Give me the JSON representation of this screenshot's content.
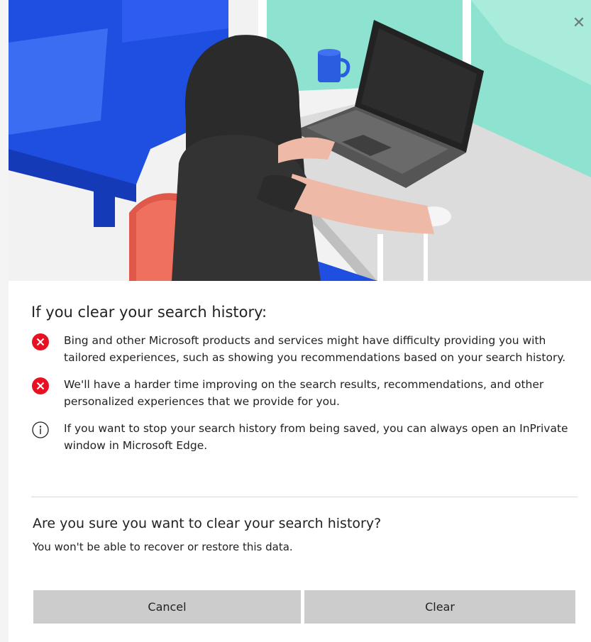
{
  "dialog": {
    "close_glyph": "✕",
    "hero_image": "woman-at-laptop-illustration",
    "section_title": "If you clear your search history:",
    "items": [
      {
        "icon": "error-x-icon",
        "text": "Bing and other Microsoft products and services might have difficulty providing you with tailored experiences, such as showing you recommendations based on your search history."
      },
      {
        "icon": "error-x-icon",
        "text": "We'll have a harder time improving on the search results, recommendations, and other personalized experiences that we provide for you."
      },
      {
        "icon": "info-icon",
        "text": "If you want to stop your search history from being saved, you can always open an InPrivate window in Microsoft Edge."
      }
    ],
    "confirm_title": "Are you sure you want to clear your search history?",
    "confirm_subtitle": "You won't be able to recover or restore this data.",
    "buttons": {
      "cancel": "Cancel",
      "clear": "Clear"
    }
  },
  "colors": {
    "error_red": "#e81123",
    "button_gray": "#cccccc",
    "teal_wall": "#8de3cf",
    "sofa_blue": "#1f4fe0"
  }
}
